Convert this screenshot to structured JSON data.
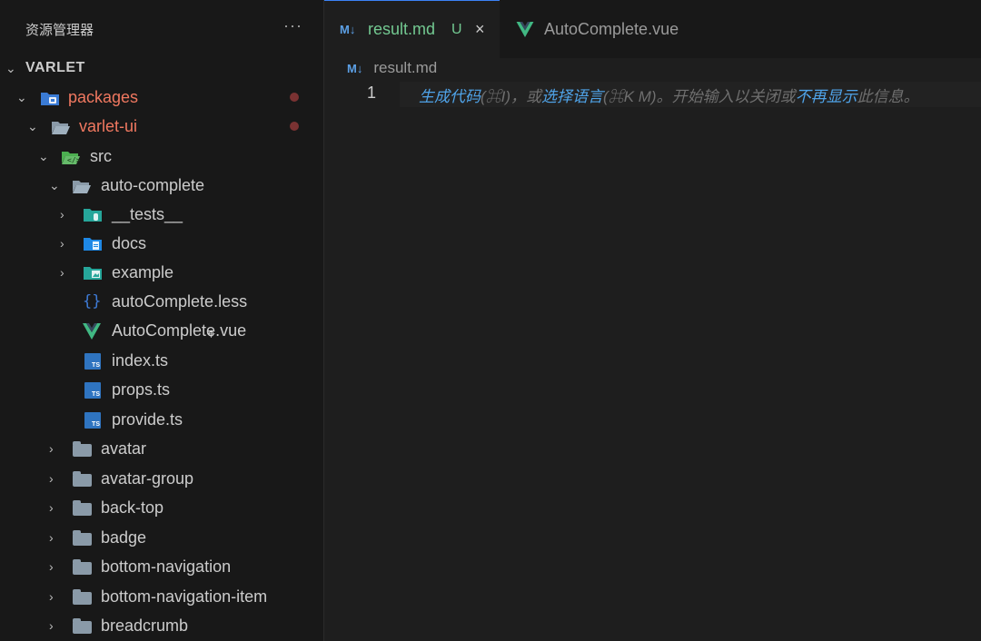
{
  "explorer": {
    "title": "资源管理器",
    "more": "···",
    "root": "VARLET"
  },
  "tree": [
    {
      "label": "packages",
      "icon": "packages-folder-icon",
      "modified": true
    },
    {
      "label": "varlet-ui",
      "icon": "folder-open-icon",
      "modified": true
    },
    {
      "label": "src",
      "icon": "src-folder-icon"
    },
    {
      "label": "auto-complete",
      "icon": "folder-open-icon"
    },
    {
      "label": "__tests__",
      "icon": "tests-folder-icon"
    },
    {
      "label": "docs",
      "icon": "docs-folder-icon"
    },
    {
      "label": "example",
      "icon": "example-folder-icon"
    },
    {
      "label": "autoComplete.less",
      "icon": "less-file-icon"
    },
    {
      "label": "AutoComplete.vue",
      "icon": "vue-file-icon"
    },
    {
      "label": "index.ts",
      "icon": "ts-file-icon"
    },
    {
      "label": "props.ts",
      "icon": "ts-file-icon"
    },
    {
      "label": "provide.ts",
      "icon": "ts-file-icon"
    },
    {
      "label": "avatar",
      "icon": "folder-icon"
    },
    {
      "label": "avatar-group",
      "icon": "folder-icon"
    },
    {
      "label": "back-top",
      "icon": "folder-icon"
    },
    {
      "label": "badge",
      "icon": "folder-icon"
    },
    {
      "label": "bottom-navigation",
      "icon": "folder-icon"
    },
    {
      "label": "bottom-navigation-item",
      "icon": "folder-icon"
    },
    {
      "label": "breadcrumb",
      "icon": "folder-icon"
    }
  ],
  "tabs": [
    {
      "label": "result.md",
      "status": "U",
      "close": "×"
    },
    {
      "label": "AutoComplete.vue"
    }
  ],
  "breadcrumb": {
    "file": "result.md",
    "icon_text": "M↓"
  },
  "editor": {
    "line_number": "1",
    "hint_part1": "生成代码",
    "hint_part2": "(⌘I)，或",
    "hint_part3": "选择语言",
    "hint_part4": "(⌘K M)。开始输入以关闭或",
    "hint_part5": "不再显示",
    "hint_part6": "此信息。"
  },
  "colors": {
    "accent": "#3b82f6",
    "modified": "#f07860",
    "untracked": "#73c991",
    "link": "#4fa3e8"
  }
}
